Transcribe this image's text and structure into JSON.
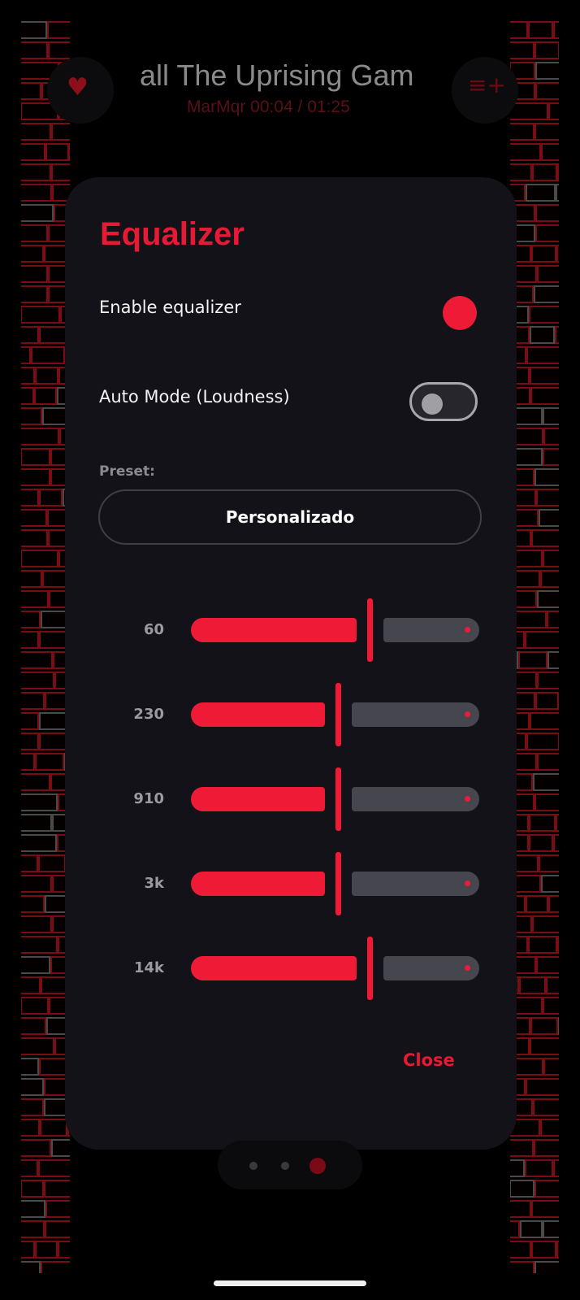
{
  "background": {
    "song_title": "all  The Uprising Gam",
    "song_meta": "MarMqr   00:04 / 01:25",
    "favorite_icon": "heart-icon",
    "queue_icon": "playlist-add-icon"
  },
  "dialog": {
    "title": "Equalizer",
    "enable_label": "Enable equalizer",
    "enable_on": true,
    "auto_label": "Auto Mode (Loudness)",
    "auto_on": false,
    "preset_label": "Preset:",
    "preset_value": "Personalizado",
    "close_label": "Close"
  },
  "bands": [
    {
      "label": "60",
      "level": 0.61
    },
    {
      "label": "230",
      "level": 0.5
    },
    {
      "label": "910",
      "level": 0.5
    },
    {
      "label": "3k",
      "level": 0.5
    },
    {
      "label": "14k",
      "level": 0.61
    }
  ],
  "pager": {
    "count": 3,
    "active_index": 2
  },
  "colors": {
    "accent": "#ef1a36",
    "track_inactive": "#46464f",
    "dialog_bg": "#121218"
  }
}
